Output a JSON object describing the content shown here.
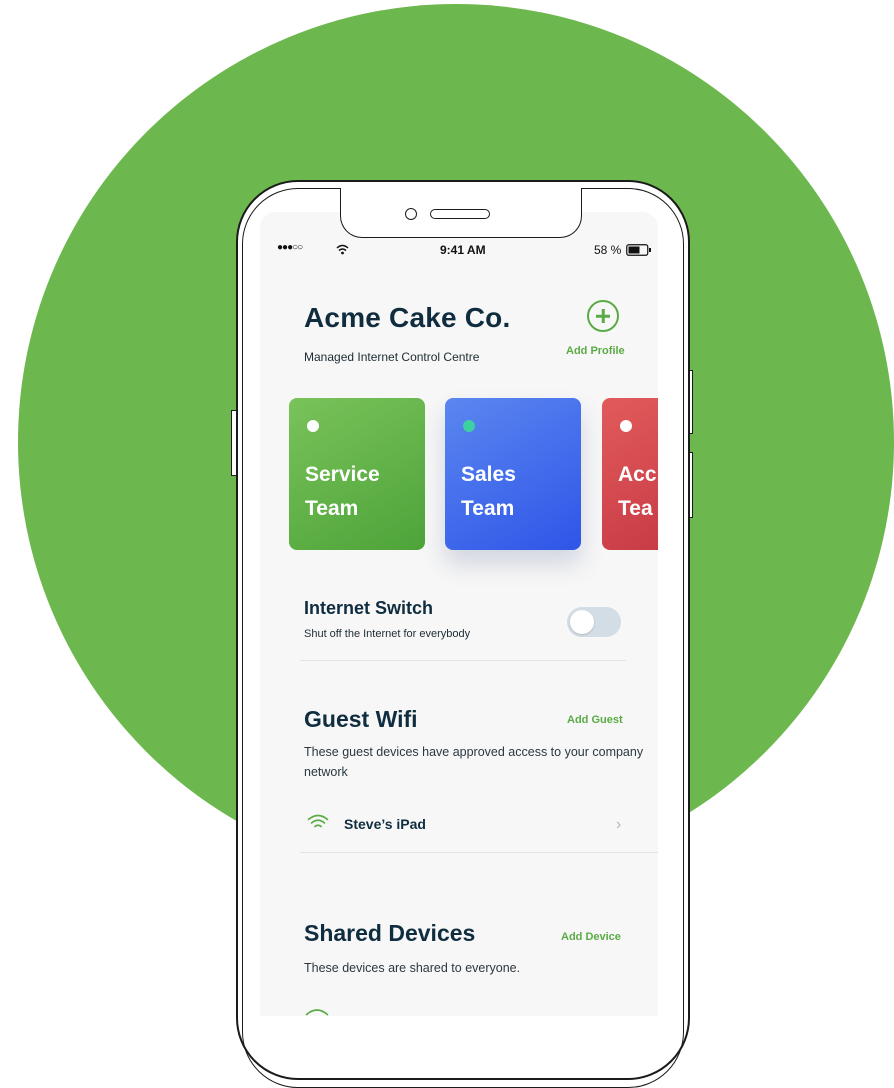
{
  "status_bar": {
    "signal": "●●●○○",
    "time": "9:41 AM",
    "battery": "58 %"
  },
  "header": {
    "title": "Acme Cake Co.",
    "subtitle": "Managed Internet Control Centre",
    "add_profile_label": "Add Profile"
  },
  "teams": [
    {
      "label": "Service\nTeam",
      "dot_color": "#ffffff"
    },
    {
      "label": "Sales\nTeam",
      "dot_color": "#3ed0a0"
    },
    {
      "label": "Acc\nTea",
      "dot_color": "#ffffff"
    }
  ],
  "internet_switch": {
    "title": "Internet Switch",
    "description": "Shut off the Internet for everybody",
    "enabled": false
  },
  "guest_wifi": {
    "title": "Guest Wifi",
    "action_label": "Add Guest",
    "description": "These guest devices have approved access to your company network",
    "devices": [
      {
        "name": "Steve’s iPad",
        "icon": "wifi-icon"
      }
    ]
  },
  "shared_devices": {
    "title": "Shared Devices",
    "action_label": "Add Device",
    "description": "These devices are shared to everyone."
  },
  "colors": {
    "background_circle": "#6cb84f",
    "accent_green": "#5aab46",
    "heading": "#0f2d3f"
  }
}
